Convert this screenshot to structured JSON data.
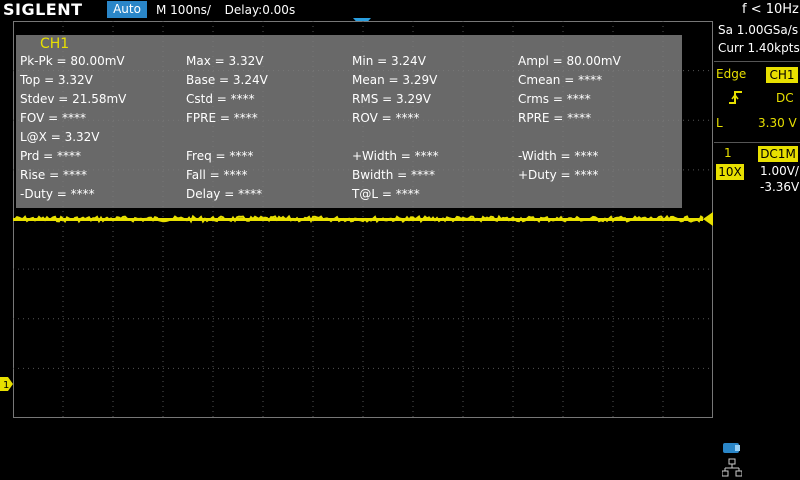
{
  "header": {
    "brand": "SIGLENT",
    "run_state": "Auto",
    "timebase": "M 100ns/",
    "delay": "Delay:0.00s",
    "frequency": "f < 10Hz"
  },
  "acquisition": {
    "sample_rate": "Sa 1.00GSa/s",
    "memory": "Curr 1.40kpts"
  },
  "trigger": {
    "type_label": "Edge",
    "source": "CH1",
    "coupling": "DC",
    "level_label": "L",
    "level_value": "3.30 V",
    "slope_icon": "rising-edge-icon"
  },
  "channel1": {
    "number": "1",
    "coupling": "DC1M",
    "probe": "10X",
    "scale": "1.00V/",
    "offset": "-3.36V",
    "ground_label": "1"
  },
  "measurements": {
    "channel": "CH1",
    "rows": [
      [
        "Pk-Pk = 80.00mV",
        "Max = 3.32V",
        "Min = 3.24V",
        "Ampl = 80.00mV"
      ],
      [
        "Top = 3.32V",
        "Base = 3.24V",
        "Mean = 3.29V",
        "Cmean = ****"
      ],
      [
        "Stdev = 21.58mV",
        "Cstd = ****",
        "RMS = 3.29V",
        "Crms = ****"
      ],
      [
        "FOV = ****",
        "FPRE = ****",
        "ROV = ****",
        "RPRE = ****"
      ],
      [
        "L@X = 3.32V",
        "",
        "",
        ""
      ],
      [
        "Prd = ****",
        "Freq = ****",
        "+Width = ****",
        "-Width = ****"
      ],
      [
        "Rise = ****",
        "Fall = ****",
        "Bwidth = ****",
        "+Duty = ****"
      ],
      [
        "-Duty = ****",
        "Delay = ****",
        "T@L = ****",
        ""
      ]
    ]
  },
  "colors": {
    "ch1": "#e8e000",
    "accent": "#2a86c8",
    "trigger_marker": "#2a9fe0",
    "panel": "#808080"
  },
  "icons": {
    "usb": "usb-icon",
    "network": "network-icon"
  }
}
